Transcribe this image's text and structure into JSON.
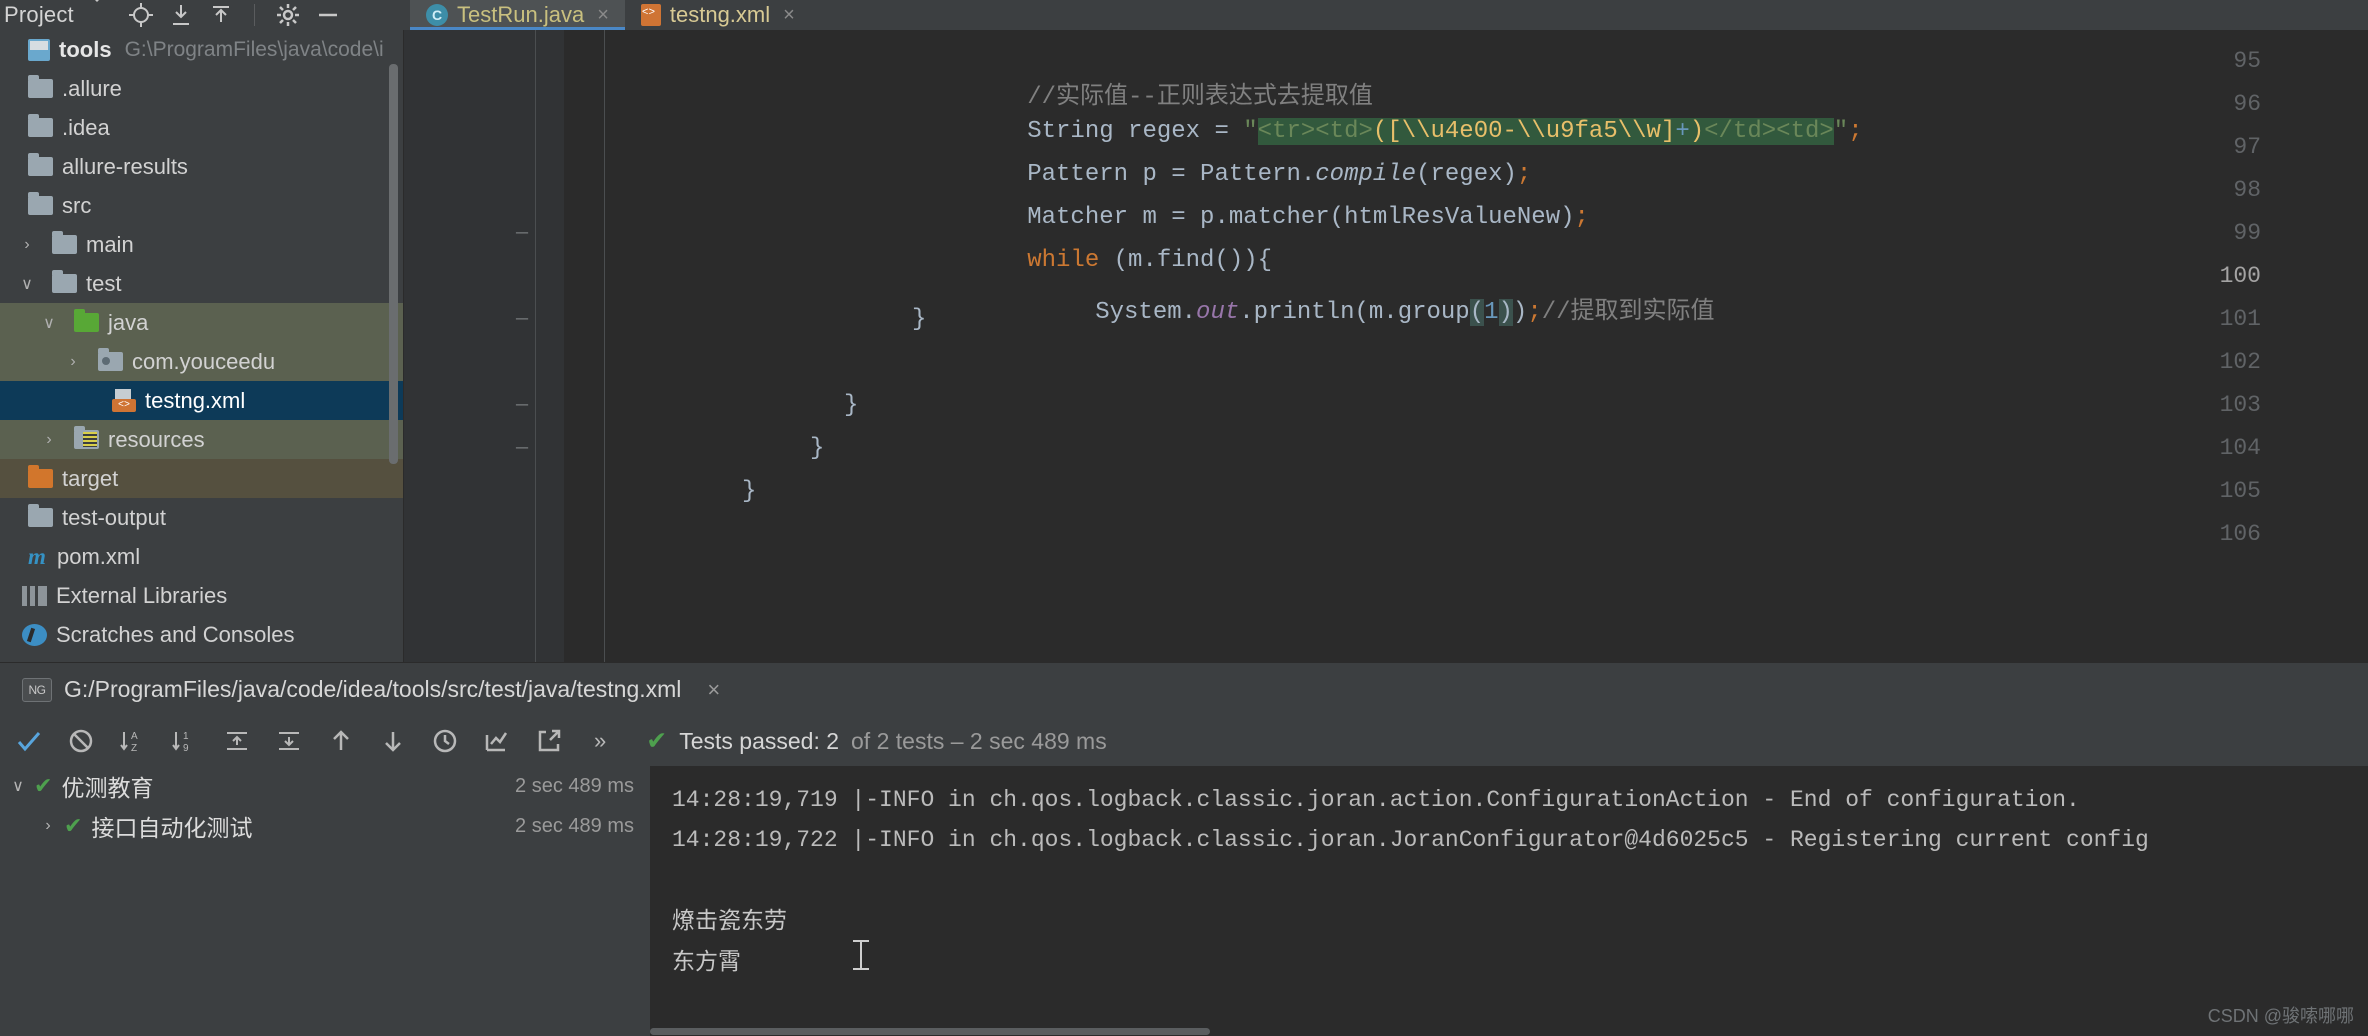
{
  "toolwindow": {
    "title": "Project",
    "icons": [
      "chevron-down-icon",
      "locate-icon",
      "expand-all-icon",
      "collapse-all-icon",
      "settings-gear-icon",
      "minimize-icon"
    ]
  },
  "tabs": [
    {
      "label": "TestRun.java",
      "icon": "java-class-icon",
      "active": true,
      "close": "×"
    },
    {
      "label": "testng.xml",
      "icon": "xml-file-icon",
      "active": false,
      "close": "×"
    }
  ],
  "project_tree": [
    {
      "label": "tools",
      "path": "G:\\ProgramFiles\\java\\code\\i",
      "type": "module",
      "indent": 0,
      "arrow": "",
      "state": "none"
    },
    {
      "label": ".allure",
      "type": "folder",
      "indent": 0,
      "arrow": "",
      "state": "none"
    },
    {
      "label": ".idea",
      "type": "folder",
      "indent": 0,
      "arrow": "",
      "state": "none"
    },
    {
      "label": "allure-results",
      "type": "folder",
      "indent": 0,
      "arrow": "",
      "state": "none"
    },
    {
      "label": "src",
      "type": "folder",
      "indent": 0,
      "arrow": "",
      "state": "none"
    },
    {
      "label": "main",
      "type": "folder",
      "indent": 1,
      "arrow": "›",
      "state": "none"
    },
    {
      "label": "test",
      "type": "folder",
      "indent": 1,
      "arrow": "∨",
      "state": "none"
    },
    {
      "label": "java",
      "type": "folder-green",
      "indent": 2,
      "arrow": "∨",
      "state": "green"
    },
    {
      "label": "com.youceedu",
      "type": "folder-src",
      "indent": 3,
      "arrow": "›",
      "state": "green"
    },
    {
      "label": "testng.xml",
      "type": "xml",
      "indent": 4,
      "arrow": "",
      "state": "blue"
    },
    {
      "label": "resources",
      "type": "folder-res",
      "indent": 2,
      "arrow": "›",
      "state": "green"
    },
    {
      "label": "target",
      "type": "folder-orange",
      "indent": 0,
      "arrow": "",
      "state": "brown"
    },
    {
      "label": "test-output",
      "type": "folder",
      "indent": 0,
      "arrow": "",
      "state": "none"
    },
    {
      "label": "pom.xml",
      "type": "maven",
      "indent": 0,
      "arrow": "",
      "state": "none"
    },
    {
      "label": "External Libraries",
      "type": "library",
      "indent": 0,
      "arrow": "",
      "state": "none"
    },
    {
      "label": "Scratches and Consoles",
      "type": "scratch",
      "indent": 0,
      "arrow": "",
      "state": "none"
    }
  ],
  "editor": {
    "line_numbers": [
      95,
      96,
      97,
      98,
      99,
      100,
      101,
      102,
      103,
      104,
      105,
      106
    ],
    "lines": [
      {
        "n": 95,
        "text": "        //实际值--正则表达式去提取值"
      },
      {
        "n": 96,
        "text": "        String regex = \"<tr><td>([\\\\u4e00-\\\\u9fa5\\\\w]+)</td><td>\";"
      },
      {
        "n": 97,
        "text": "        Pattern p = Pattern.compile(regex);"
      },
      {
        "n": 98,
        "text": "        Matcher m = p.matcher(htmlResValueNew);"
      },
      {
        "n": 99,
        "text": "        while (m.find()){"
      },
      {
        "n": 100,
        "text": "            System.out.println(m.group(1));//提取到实际值"
      },
      {
        "n": 101,
        "text": "        }"
      },
      {
        "n": 102,
        "text": ""
      },
      {
        "n": 103,
        "text": "    }"
      },
      {
        "n": 104,
        "text": "  }"
      },
      {
        "n": 105,
        "text": "}"
      },
      {
        "n": 106,
        "text": ""
      }
    ],
    "l95_comment": "//实际值--正则表达式去提取值",
    "l96_decl": "String regex = ",
    "l96_quote_open": "\"",
    "l96_tag_open": "<tr><td>",
    "l96_regex_body": "([\\\\u4e00-\\\\u9fa5\\\\w]",
    "l96_plus": "+",
    "l96_close_paren": ")",
    "l96_tag_close": "</td><td>",
    "l96_quote_close": "\"",
    "l96_semi": ";",
    "l97_a": "Pattern p = Pattern.",
    "l97_b": "compile",
    "l97_c": "(regex)",
    "l97_semi": ";",
    "l98_a": "Matcher m = p.matcher(htmlResValueNew)",
    "l98_semi": ";",
    "l99_kw": "while",
    "l99_rest": " (m.find()){",
    "l100_a": "System.",
    "l100_out": "out",
    "l100_b": ".println(m.group",
    "l100_p1": "(",
    "l100_n1": "1",
    "l100_p2": ")",
    "l100_c": ")",
    "l100_semi": ";",
    "l100_cmt": "//提取到实际值",
    "l101": "}",
    "l103": "}",
    "l104": "}",
    "l105": "}"
  },
  "breadcrumb": {
    "icon": "testng-icon",
    "icon_text": "NG",
    "path": "G:/ProgramFiles/java/code/idea/tools/src/test/java/testng.xml",
    "close": "×"
  },
  "run_toolbar": {
    "icons": [
      "show-passed-icon",
      "hide-ignored-icon",
      "sort-alphabetically-icon",
      "sort-by-duration-icon",
      "expand-all-icon",
      "collapse-all-icon",
      "prev-failed-icon",
      "next-failed-icon",
      "history-icon",
      "export-results-icon",
      "open-in-browser-icon"
    ],
    "more": "»",
    "status_check": "✔",
    "status_text": "Tests passed: 2",
    "status_detail": " of 2 tests – 2 sec 489 ms"
  },
  "run_tree": [
    {
      "arrow": "∨",
      "check": "✔",
      "label": "优测教育",
      "duration": "2 sec 489 ms",
      "indent": 0
    },
    {
      "arrow": "›",
      "check": "✔",
      "label": "接口自动化测试",
      "duration": "2 sec 489 ms",
      "indent": 1
    }
  ],
  "console": {
    "lines": [
      "14:28:19,719 |-INFO in ch.qos.logback.classic.joran.action.ConfigurationAction - End of configuration.",
      "14:28:19,722 |-INFO in ch.qos.logback.classic.joran.JoranConfigurator@4d6025c5 - Registering current config"
    ],
    "output": [
      "燎击瓷东劳",
      "东方霄"
    ]
  },
  "watermark": "CSDN @骏嗦哪哪",
  "colors": {
    "accent_blue": "#4a88c7",
    "selection_blue": "#0d3a58",
    "selection_green": "#5b6150",
    "pass_green": "#4ea04e",
    "string_green": "#6a8759",
    "keyword_orange": "#cc7832"
  }
}
